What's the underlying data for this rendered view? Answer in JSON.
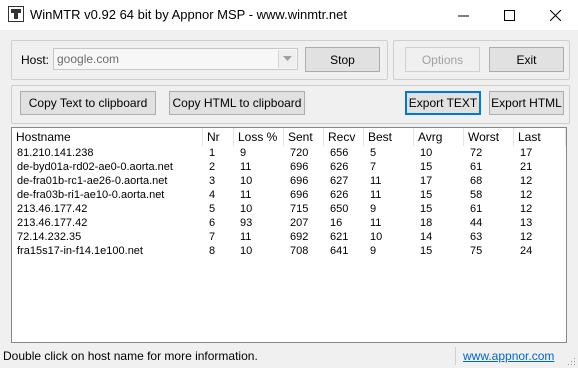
{
  "window": {
    "title": "WinMTR v0.92 64 bit by Appnor MSP - www.winmtr.net"
  },
  "host": {
    "label": "Host:",
    "value": "google.com"
  },
  "buttons": {
    "stop": "Stop",
    "options": "Options",
    "exit": "Exit",
    "copy_text": "Copy Text to clipboard",
    "copy_html": "Copy HTML to clipboard",
    "export_text": "Export TEXT",
    "export_html": "Export HTML"
  },
  "table": {
    "columns": [
      "Hostname",
      "Nr",
      "Loss %",
      "Sent",
      "Recv",
      "Best",
      "Avrg",
      "Worst",
      "Last"
    ],
    "rows": [
      [
        "81.210.141.238",
        "1",
        "9",
        "720",
        "656",
        "5",
        "10",
        "72",
        "17"
      ],
      [
        "de-byd01a-rd02-ae0-0.aorta.net",
        "2",
        "11",
        "696",
        "626",
        "7",
        "15",
        "61",
        "21"
      ],
      [
        "de-fra01b-rc1-ae26-0.aorta.net",
        "3",
        "10",
        "696",
        "627",
        "11",
        "17",
        "68",
        "12"
      ],
      [
        "de-fra03b-ri1-ae10-0.aorta.net",
        "4",
        "11",
        "696",
        "626",
        "11",
        "15",
        "58",
        "12"
      ],
      [
        "213.46.177.42",
        "5",
        "10",
        "715",
        "650",
        "9",
        "15",
        "61",
        "12"
      ],
      [
        "213.46.177.42",
        "6",
        "93",
        "207",
        "16",
        "11",
        "18",
        "44",
        "13"
      ],
      [
        "72.14.232.35",
        "7",
        "11",
        "692",
        "621",
        "10",
        "14",
        "63",
        "12"
      ],
      [
        "fra15s17-in-f14.1e100.net",
        "8",
        "10",
        "708",
        "641",
        "9",
        "15",
        "75",
        "24"
      ]
    ]
  },
  "status": {
    "message": "Double click on host name for more information.",
    "link": "www.appnor.com"
  },
  "icons": {
    "app": "winmtr-app-icon",
    "minimize": "minimize-icon",
    "maximize": "maximize-icon",
    "close": "close-icon",
    "dropdown": "chevron-down-icon",
    "resize": "resize-grip-icon"
  },
  "colors": {
    "accent": "#0078d7",
    "link": "#0066cc"
  }
}
